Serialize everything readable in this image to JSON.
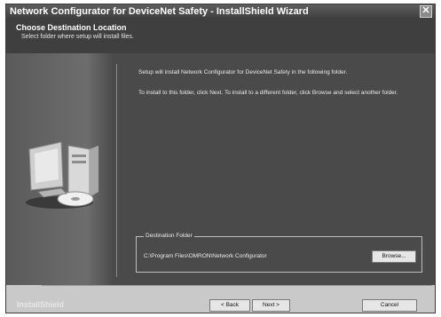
{
  "window": {
    "title": "Network Configurator for DeviceNet Safety - InstallShield Wizard",
    "close_glyph": "✕"
  },
  "header": {
    "title": "Choose Destination Location",
    "subtitle": "Select folder where setup will install files."
  },
  "body": {
    "message1": "Setup will install Network Configurator for DeviceNet Safety in the following folder.",
    "message2": "To install to this folder, click Next. To install to a different folder, click Browse and select another folder.",
    "icon": "computer-install-icon"
  },
  "destination": {
    "legend": "Destination Folder",
    "path": "C:\\Program Files\\OMRON\\Network Configurator",
    "browse_label": "Browse..."
  },
  "footer": {
    "brand": "InstallShield",
    "back_label": "< Back",
    "next_label": "Next >",
    "cancel_label": "Cancel"
  }
}
